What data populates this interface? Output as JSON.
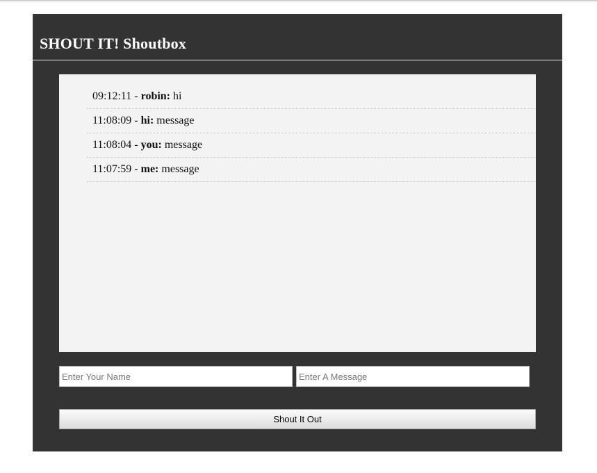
{
  "header": {
    "title": "SHOUT IT! Shoutbox"
  },
  "shouts": [
    {
      "time": "09:12:11",
      "name": "robin:",
      "message": "hi"
    },
    {
      "time": "11:08:09",
      "name": "hi:",
      "message": "message"
    },
    {
      "time": "11:08:04",
      "name": "you:",
      "message": "message"
    },
    {
      "time": "11:07:59",
      "name": "me:",
      "message": "message"
    }
  ],
  "form": {
    "name_placeholder": "Enter Your Name",
    "message_placeholder": "Enter A Message",
    "submit_label": "Shout It Out"
  },
  "colors": {
    "panel_bg": "#333333",
    "shouts_bg": "#f3f3f3"
  }
}
